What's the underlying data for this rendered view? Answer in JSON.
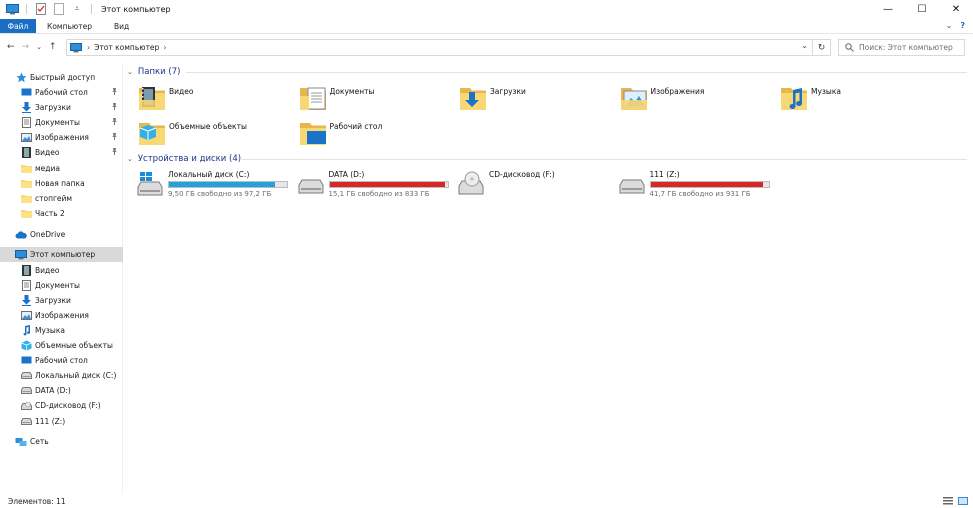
{
  "window": {
    "title": "Этот компьютер",
    "controls": {
      "minimize": "—",
      "maximize": "☐",
      "close": "✕"
    }
  },
  "ribbon": {
    "tabs": [
      "Файл",
      "Компьютер",
      "Вид"
    ],
    "expand": "⌄",
    "help": "?"
  },
  "address": {
    "back": "←",
    "forward": "→",
    "recent": "⌄",
    "up": "↑",
    "crumb": "Этот компьютер",
    "search_placeholder": "Поиск: Этот компьютер"
  },
  "navpane": {
    "quick_access": "Быстрый доступ",
    "quick_items": [
      {
        "label": "Рабочий стол",
        "icon": "desktop-icon",
        "pinned": true
      },
      {
        "label": "Загрузки",
        "icon": "downloads-icon",
        "pinned": true
      },
      {
        "label": "Документы",
        "icon": "documents-icon",
        "pinned": true
      },
      {
        "label": "Изображения",
        "icon": "pictures-icon",
        "pinned": true
      },
      {
        "label": "Видео",
        "icon": "video-icon",
        "pinned": true
      },
      {
        "label": "медиа",
        "icon": "folder-icon",
        "pinned": false
      },
      {
        "label": "Новая папка",
        "icon": "folder-icon",
        "pinned": false
      },
      {
        "label": "стопгейм",
        "icon": "folder-icon",
        "pinned": false
      },
      {
        "label": "Часть 2",
        "icon": "folder-icon",
        "pinned": false
      }
    ],
    "onedrive": "OneDrive",
    "this_pc": "Этот компьютер",
    "pc_items": [
      {
        "label": "Видео",
        "icon": "video-icon"
      },
      {
        "label": "Документы",
        "icon": "documents-icon"
      },
      {
        "label": "Загрузки",
        "icon": "downloads-icon"
      },
      {
        "label": "Изображения",
        "icon": "pictures-icon"
      },
      {
        "label": "Музыка",
        "icon": "music-icon"
      },
      {
        "label": "Объемные объекты",
        "icon": "3d-objects-icon"
      },
      {
        "label": "Рабочий стол",
        "icon": "desktop-icon"
      },
      {
        "label": "Локальный диск (C:)",
        "icon": "drive-icon"
      },
      {
        "label": "DATA (D:)",
        "icon": "drive-icon"
      },
      {
        "label": "CD-дисковод (F:)",
        "icon": "cd-drive-icon"
      },
      {
        "label": "111 (Z:)",
        "icon": "drive-icon"
      }
    ],
    "network": "Сеть"
  },
  "content": {
    "folders_header": "Папки (7)",
    "folders": [
      {
        "label": "Видео",
        "icon": "video-folder-icon"
      },
      {
        "label": "Документы",
        "icon": "documents-folder-icon"
      },
      {
        "label": "Загрузки",
        "icon": "downloads-folder-icon"
      },
      {
        "label": "Изображения",
        "icon": "pictures-folder-icon"
      },
      {
        "label": "Музыка",
        "icon": "music-folder-icon"
      },
      {
        "label": "Объемные объекты",
        "icon": "3d-objects-folder-icon"
      },
      {
        "label": "Рабочий стол",
        "icon": "desktop-folder-icon"
      }
    ],
    "drives_header": "Устройства и диски (4)",
    "drives": [
      {
        "label": "Локальный диск (C:)",
        "free": "9,50 ГБ свободно из 97,2 ГБ",
        "used_fraction": 0.902,
        "bar_color": "#26a0da",
        "icon": "windows-drive-icon"
      },
      {
        "label": "DATA (D:)",
        "free": "15,1 ГБ свободно из 833 ГБ",
        "used_fraction": 0.982,
        "bar_color": "#da2626",
        "icon": "drive-icon"
      },
      {
        "label": "CD-дисковод (F:)",
        "free": "",
        "used_fraction": null,
        "bar_color": "",
        "icon": "cd-drive-icon"
      },
      {
        "label": "111 (Z:)",
        "free": "41,7 ГБ свободно из 931 ГБ",
        "used_fraction": 0.955,
        "bar_color": "#da2626",
        "icon": "drive-icon"
      }
    ]
  },
  "status": {
    "items": "Элементов: 11"
  },
  "colors": {
    "accent": "#1a6fc4",
    "folder_yellow": "#f8d775",
    "group_header": "#1e3287"
  }
}
